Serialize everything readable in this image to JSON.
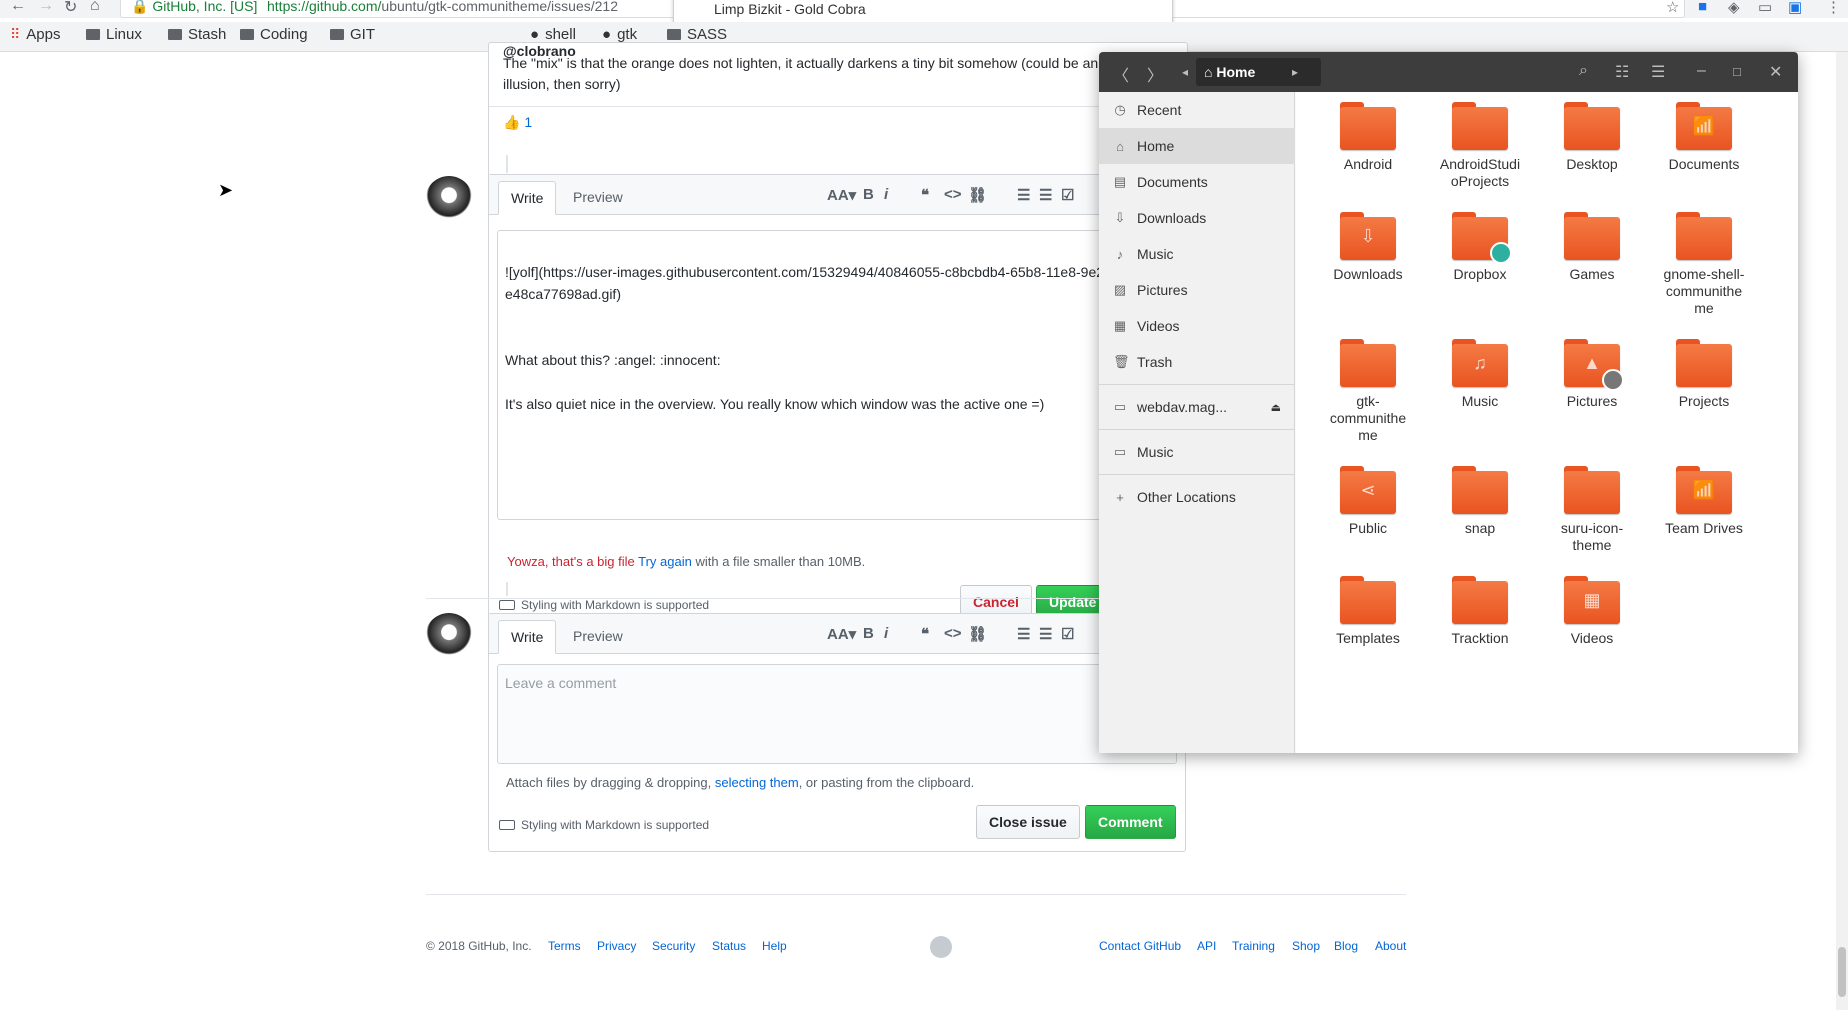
{
  "browser": {
    "secure_label": "GitHub, Inc. [US]",
    "url_main": "https://github.com/",
    "url_rest": "ubuntu/gtk-communitheme/issues/212",
    "dropdown_text": "Limp Bizkit - Gold Cobra",
    "bookmarks": [
      "Apps",
      "Linux",
      "Stash",
      "Coding",
      "GIT",
      "shell",
      "gtk",
      "SASS"
    ]
  },
  "comment_top": {
    "mention": "@clobrano",
    "text_line1": "The \"mix\" is that the orange does not lighten, it actually darkens a tiny bit somehow (could be an",
    "text_line2": "illusion, then sorry)",
    "reaction_emoji": "👍",
    "reaction_count": "1"
  },
  "edit_form": {
    "tab_write": "Write",
    "tab_preview": "Preview",
    "line1": "![yolf](https://user-images.githubusercontent.com/15329494/40846055-c8bcbdb4-65b8-11e8-9e2",
    "line2": "e48ca77698ad.gif)",
    "line3": "What about this? :angel: :innocent:",
    "line4": "It's also quiet nice in the overview. You really know which window was the active one =)",
    "error_text": "Yowza, that's a big file",
    "try_again": "Try again",
    "error_rest": "with a file smaller than 10MB.",
    "markdown_note": "Styling with Markdown is supported",
    "cancel": "Cancel",
    "update": "Update"
  },
  "new_comment": {
    "tab_write": "Write",
    "tab_preview": "Preview",
    "placeholder": "Leave a comment",
    "attach_pre": "Attach files by dragging & dropping,",
    "attach_link": "selecting them",
    "attach_post": ", or pasting from the clipboard.",
    "markdown_note": "Styling with Markdown is supported",
    "close_issue": "Close issue",
    "comment": "Comment"
  },
  "footer": {
    "copyright": "© 2018 GitHub, Inc.",
    "left_links": [
      "Terms",
      "Privacy",
      "Security",
      "Status",
      "Help"
    ],
    "right_links": [
      "Contact GitHub",
      "API",
      "Training",
      "Shop",
      "Blog",
      "About"
    ]
  },
  "files": {
    "location": "Home",
    "sidebar": [
      "Recent",
      "Home",
      "Documents",
      "Downloads",
      "Music",
      "Pictures",
      "Videos",
      "Trash",
      "webdav.mag...",
      "Music",
      "Other Locations"
    ],
    "items": [
      {
        "line1": "Android",
        "line2": "",
        "line3": "",
        "emblem": ""
      },
      {
        "line1": "AndroidStudi",
        "line2": "oProjects",
        "line3": "",
        "emblem": ""
      },
      {
        "line1": "Desktop",
        "line2": "",
        "line3": "",
        "emblem": ""
      },
      {
        "line1": "Documents",
        "line2": "",
        "line3": "",
        "emblem": "📶"
      },
      {
        "line1": "Downloads",
        "line2": "",
        "line3": "",
        "emblem": "⇩"
      },
      {
        "line1": "Dropbox",
        "line2": "",
        "line3": "",
        "emblem": ""
      },
      {
        "line1": "Games",
        "line2": "",
        "line3": "",
        "emblem": ""
      },
      {
        "line1": "gnome-shell-",
        "line2": "communithe",
        "line3": "me",
        "emblem": ""
      },
      {
        "line1": "gtk-",
        "line2": "communithe",
        "line3": "me",
        "emblem": ""
      },
      {
        "line1": "Music",
        "line2": "",
        "line3": "",
        "emblem": "♫"
      },
      {
        "line1": "Pictures",
        "line2": "",
        "line3": "",
        "emblem": "▲"
      },
      {
        "line1": "Projects",
        "line2": "",
        "line3": "",
        "emblem": ""
      },
      {
        "line1": "Public",
        "line2": "",
        "line3": "",
        "emblem": "⋖"
      },
      {
        "line1": "snap",
        "line2": "",
        "line3": "",
        "emblem": ""
      },
      {
        "line1": "suru-icon-",
        "line2": "theme",
        "line3": "",
        "emblem": ""
      },
      {
        "line1": "Team Drives",
        "line2": "",
        "line3": "",
        "emblem": "📶"
      },
      {
        "line1": "Templates",
        "line2": "",
        "line3": "",
        "emblem": ""
      },
      {
        "line1": "Tracktion",
        "line2": "",
        "line3": "",
        "emblem": ""
      },
      {
        "line1": "Videos",
        "line2": "",
        "line3": "",
        "emblem": "▦"
      }
    ]
  },
  "colors": {
    "ubuntu_orange": "#e95420",
    "github_green": "#28a745",
    "link_blue": "#0366d6"
  }
}
